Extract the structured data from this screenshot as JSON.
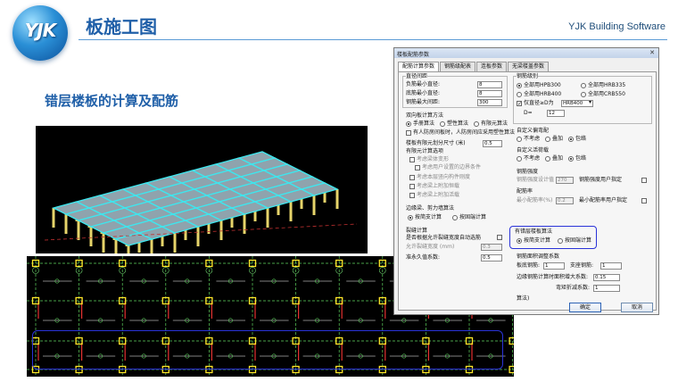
{
  "header": {
    "logo_text": "YJK",
    "title": "板施工图",
    "brand": "YJK Building Software"
  },
  "subtitle": "错层楼板的计算及配筋",
  "dialog": {
    "title": "楼板配筋参数",
    "tabs": [
      "配筋计算参数",
      "钢筋级配表",
      "连板参数",
      "无梁楼盖参数"
    ],
    "left": {
      "spacing_header": "直径间距",
      "neg_min_dia_label": "负筋最小直径:",
      "neg_min_dia": "8",
      "bot_min_dia_label": "底筋最小直径:",
      "bot_min_dia": "8",
      "max_spacing_label": "钢筋最大间距:",
      "max_spacing": "300",
      "method_header": "双向板计算方法",
      "method_options": [
        "手册算法",
        "塑性算法",
        "有限元算法"
      ],
      "fire_check_label": "有人防房间板时，人防房间应采用塑性算法",
      "fem_size_label": "楼板有限元划分尺寸 (米)",
      "fem_size": "0.5",
      "fem_options_header": "有限元计算选项",
      "fem_opt1": "考虑梁体变形",
      "fem_opt2": "考虑用户设置的边界条件",
      "fem_opt3": "考虑本层竖向构件刚度",
      "fem_opt4": "考虑梁上附加恒载",
      "fem_opt5": "考虑梁上附加活载",
      "boundary_header": "边缘梁、剪力墙算法",
      "boundary_options": [
        "按简支计算",
        "按固端计算"
      ],
      "crack_header": "裂缝计算",
      "crack_auto_label": "是否根据允许裂缝宽度自动选筋",
      "crack_width_label": "允许裂缝宽度 (mm)",
      "crack_width": "0.3",
      "quasi_label": "准永久值系数:",
      "quasi_value": "0.5"
    },
    "right": {
      "grade_header": "钢筋级别",
      "grades": [
        "全部用HPB300",
        "全部用HRB335",
        "全部用HRB400",
        "全部用CRB550"
      ],
      "only_dia_label": "仅直径≥D为",
      "only_dia_sel": "HRB400",
      "d_label": "D=",
      "d_value": "12",
      "fire_bend_header": "自定义偏弯配",
      "fire_bend_options": [
        "不考虑",
        "叠加",
        "包络"
      ],
      "custom_header": "自定义活荷载",
      "custom_options": [
        "不考虑",
        "叠加",
        "包络"
      ],
      "strength_header": "钢筋强度",
      "strength_label": "钢筋强度设计值",
      "strength_value": "270",
      "strength_user_label": "钢筋强度用户指定",
      "ratio_header": "配筋率",
      "min_ratio_label": "最小配筋率(%)",
      "min_ratio": "0.2",
      "min_ratio_user_label": "最小配筋率用户指定",
      "staggered_header": "有错层楼板算法",
      "staggered_options": [
        "按简支计算",
        "按固端计算"
      ],
      "adjust_header": "钢筋面积调整系数",
      "slab_bottom_label": "板底钢筋:",
      "slab_bottom": "1",
      "support_label": "支座钢筋:",
      "support": "1",
      "edge_label": "边缘钢筋计算时面积增大系数:",
      "edge_value": "0.15",
      "reduce_label": "弯矩折减系数:",
      "reduce_value": "1",
      "note": "算法)"
    },
    "ok_button": "确定",
    "cancel_button": "取消"
  },
  "plan": {
    "axis_labels": [
      "①",
      "②",
      "③",
      "④",
      "⑤",
      "⑥",
      "⑦",
      "⑧",
      "⑨",
      "⑩",
      "⑪",
      "⑫"
    ]
  }
}
